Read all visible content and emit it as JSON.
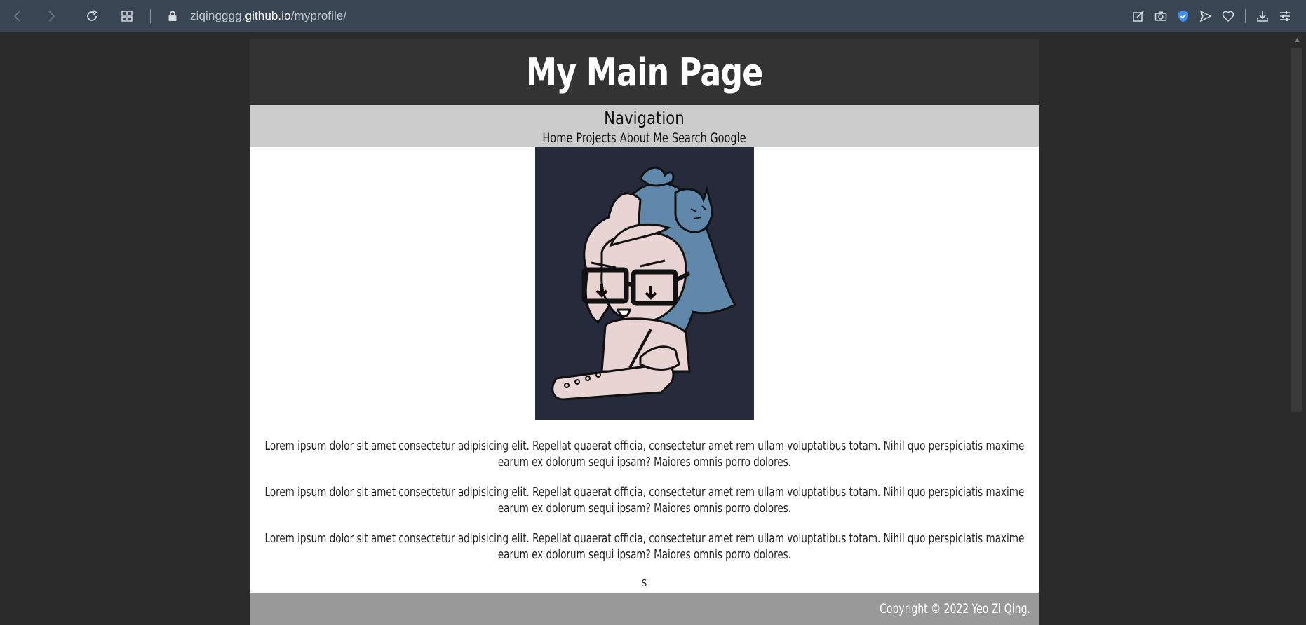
{
  "browser": {
    "url_prefix": "ziqingggg.",
    "url_domain": "github.io",
    "url_path": "/myprofile/"
  },
  "site": {
    "title": "My Main Page",
    "nav": {
      "heading": "Navigation",
      "links": [
        "Home",
        "Projects",
        "About Me",
        "Search Google"
      ]
    },
    "paragraphs": [
      "Lorem ipsum dolor sit amet consectetur adipisicing elit. Repellat quaerat officia, consectetur amet rem ullam voluptatibus totam. Nihil quo perspiciatis maxime earum ex dolorum sequi ipsam? Maiores omnis porro dolores.",
      "Lorem ipsum dolor sit amet consectetur adipisicing elit. Repellat quaerat officia, consectetur amet rem ullam voluptatibus totam. Nihil quo perspiciatis maxime earum ex dolorum sequi ipsam? Maiores omnis porro dolores.",
      "Lorem ipsum dolor sit amet consectetur adipisicing elit. Repellat quaerat officia, consectetur amet rem ullam voluptatibus totam. Nihil quo perspiciatis maxime earum ex dolorum sequi ipsam? Maiores omnis porro dolores."
    ],
    "small_text": "S",
    "footer": "Copyright © 2022 Yeo Zi Qing."
  },
  "colors": {
    "chrome_bg": "#394552",
    "page_header_bg": "#333333",
    "navbar_bg": "#cccccc",
    "footer_bg": "#999999",
    "avatar_bg": "#262a3b",
    "avatar_hair": "#5f88aa",
    "avatar_skin": "#e9d4d4"
  },
  "icons": [
    "back-icon",
    "forward-icon",
    "reload-icon",
    "speed-dial-icon",
    "lock-icon",
    "edit-icon",
    "camera-icon",
    "shield-icon",
    "send-icon",
    "heart-icon",
    "download-icon",
    "settings-sliders-icon"
  ]
}
